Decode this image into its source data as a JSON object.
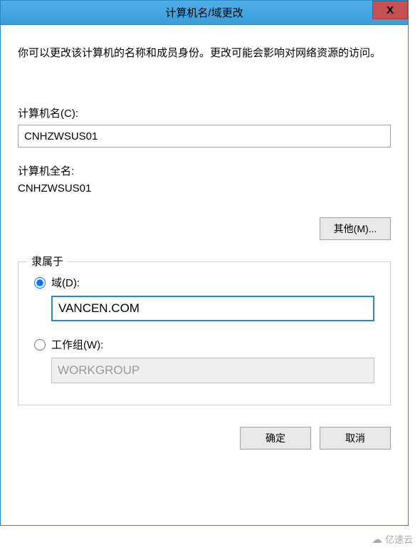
{
  "titlebar": {
    "title": "计算机名/域更改",
    "close_label": "X"
  },
  "description": "你可以更改该计算机的名称和成员身份。更改可能会影响对网络资源的访问。",
  "computer_name": {
    "label": "计算机名(C):",
    "value": "CNHZWSUS01"
  },
  "full_name": {
    "label": "计算机全名:",
    "value": "CNHZWSUS01"
  },
  "more_button": "其他(M)...",
  "membership": {
    "legend": "隶属于",
    "domain": {
      "label": "域(D):",
      "value": "VANCEN.COM",
      "selected": true
    },
    "workgroup": {
      "label": "工作组(W):",
      "value": "WORKGROUP",
      "selected": false
    }
  },
  "buttons": {
    "ok": "确定",
    "cancel": "取消"
  },
  "watermark": {
    "text": "亿速云"
  }
}
